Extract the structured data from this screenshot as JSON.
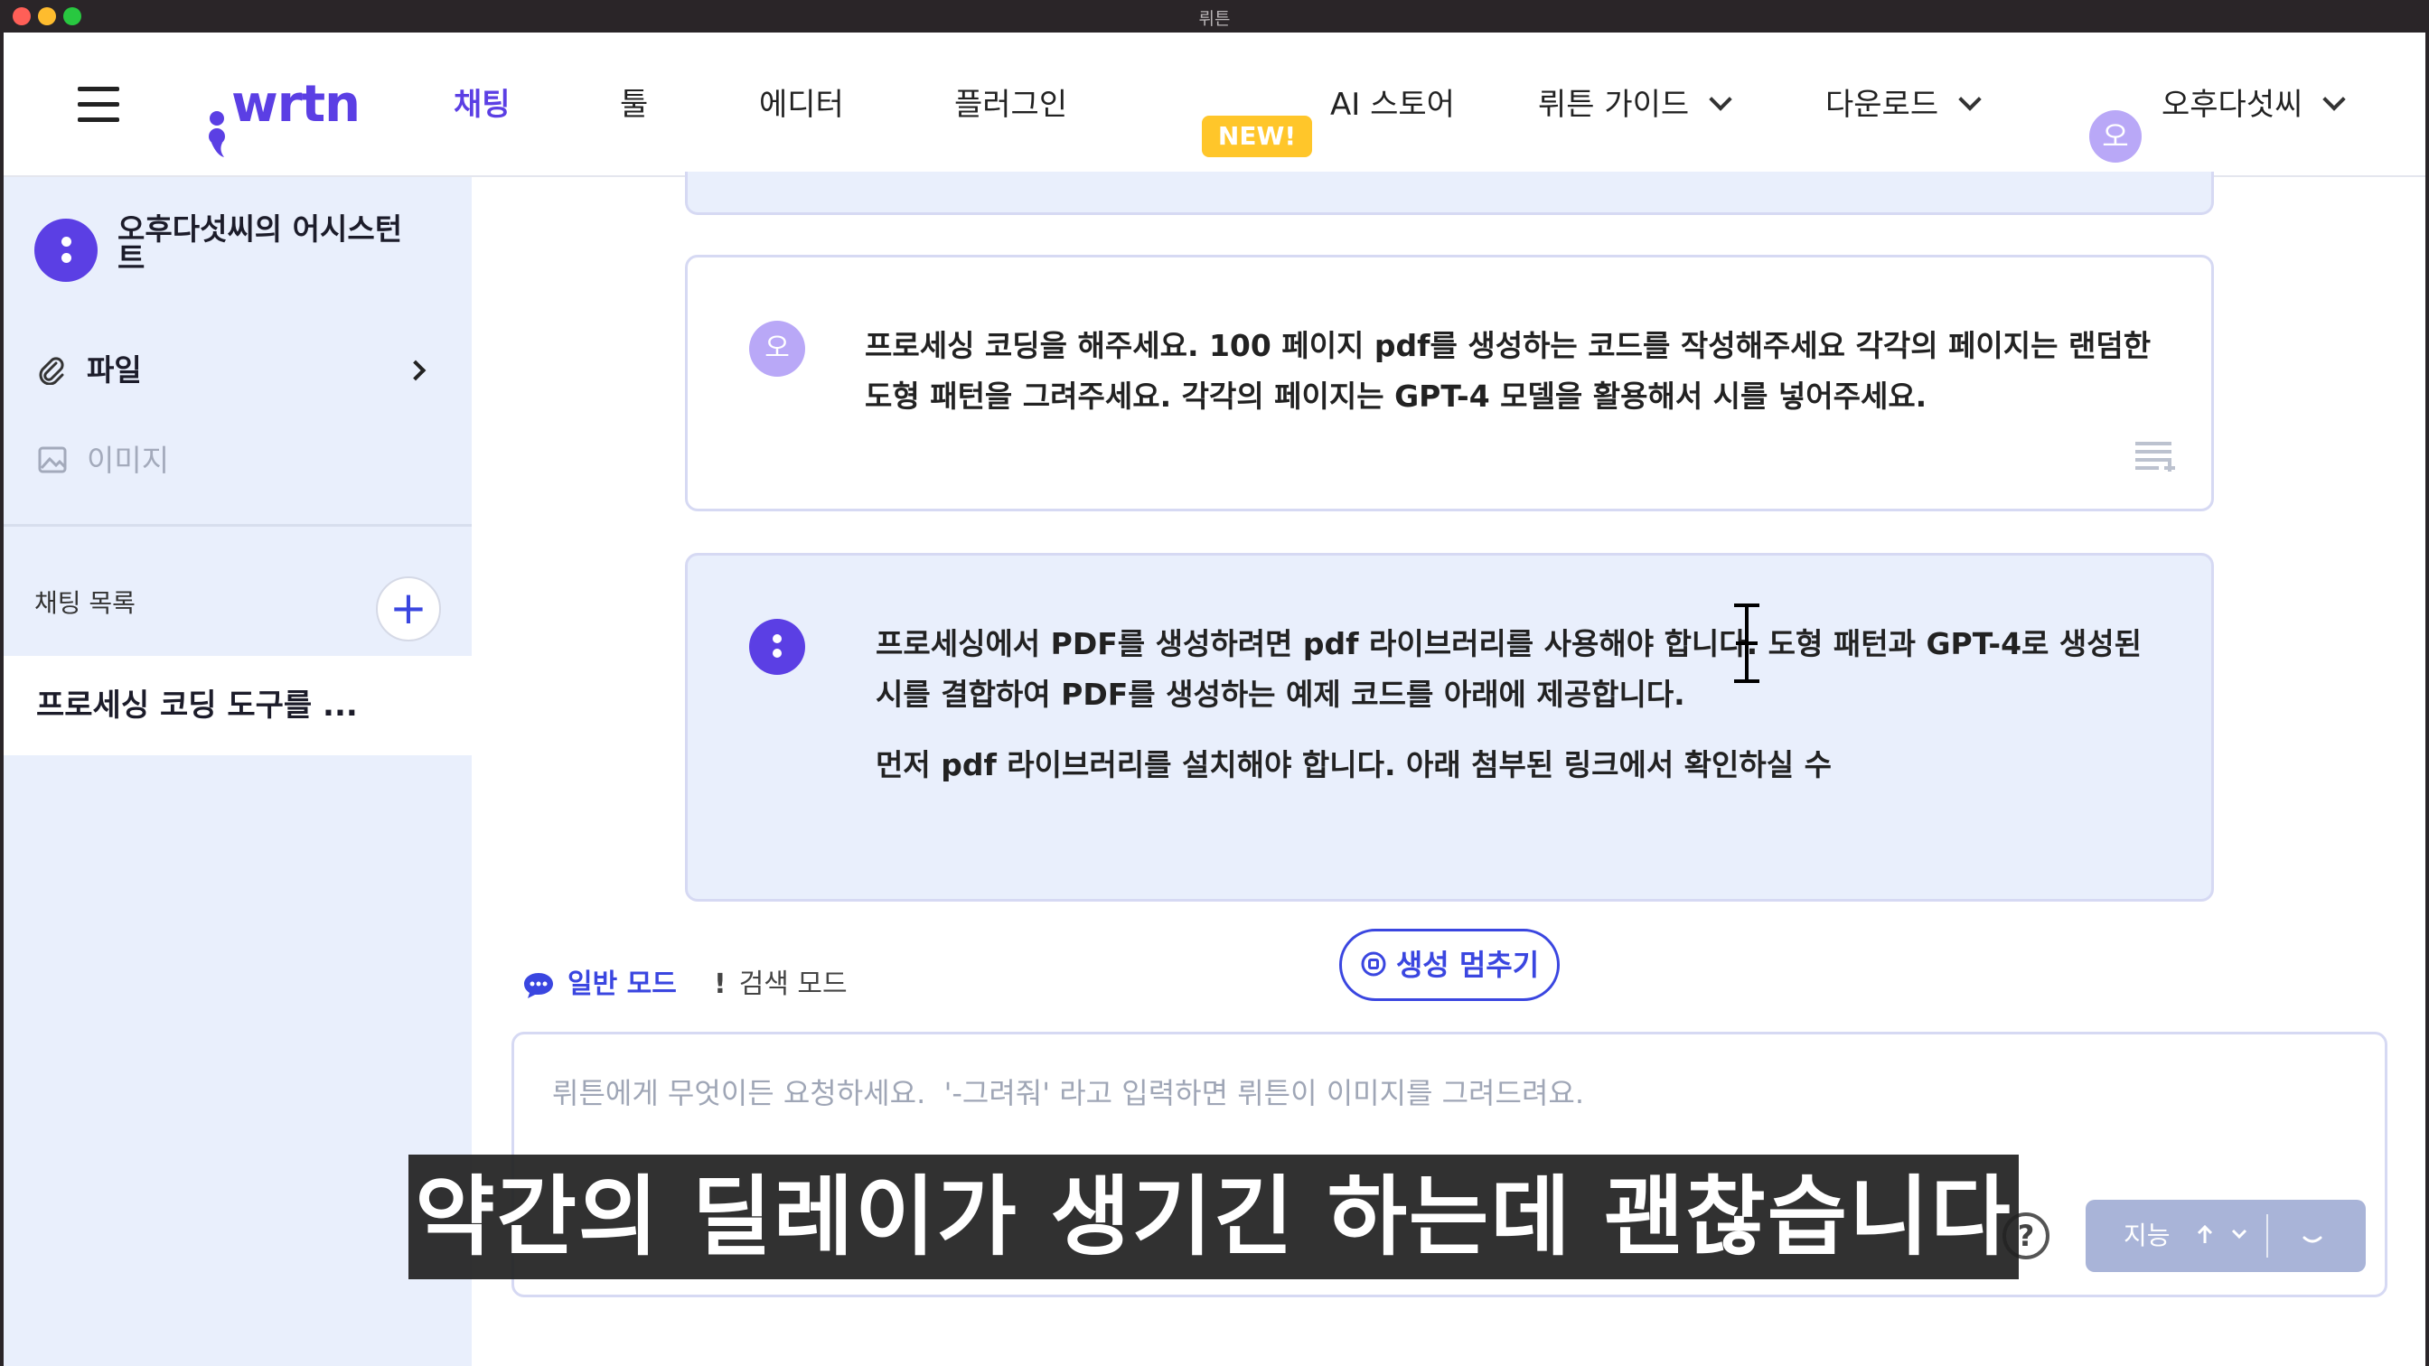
{
  "window": {
    "title": "뤼튼"
  },
  "nav": {
    "logo": "wrtn",
    "items": [
      "채팅",
      "툴",
      "에디터",
      "플러그인"
    ],
    "new_badge": "NEW!",
    "ai_store": "AI 스토어",
    "guide": "뤼튼 가이드",
    "download": "다운로드",
    "user_initial": "오",
    "user_name": "오후다섯씨"
  },
  "sidebar": {
    "assistant_name": "오후다섯씨의 어시스턴트",
    "files": "파일",
    "images": "이미지",
    "chat_list_label": "채팅 목록",
    "add_symbol": "+",
    "chat_items": [
      "프로세싱 코딩 도구를 ..."
    ]
  },
  "messages": {
    "user_initial": "오",
    "user_text": "프로세싱 코딩을 해주세요. 100 페이지 pdf를 생성하는 코드를 작성해주세요 각각의 페이지는 랜덤한 도형 패턴을 그려주세요. 각각의 페이지는 GPT-4 모델을 활용해서 시를 넣어주세요.",
    "assistant_p1": "프로세싱에서 PDF를 생성하려면 pdf 라이브러리를 사용해야 합니다. 도형 패턴과 GPT-4로 생성된 시를 결합하여 PDF를 생성하는 예제 코드를 아래에 제공합니다.",
    "assistant_p2": "먼저 pdf 라이브러리를 설치해야 합니다. 아래 첨부된 링크에서 확인하실 수"
  },
  "modes": {
    "general": "일반 모드",
    "search": "검색 모드",
    "search_mark": "!"
  },
  "stop_label": "생성 멈추기",
  "input": {
    "placeholder": "뤼튼에게 무엇이든 요청하세요.  '-그려줘' 라고 입력하면 뤼튼이 이미지를 그려드려요."
  },
  "model_select": {
    "label": "지능"
  },
  "subtitle": "약간의 딜레이가 생기긴 하는데 괜찮습니다",
  "colors": {
    "brand": "#5b3fe4",
    "accent": "#3a46e0",
    "badge": "#ffc62a",
    "sidebar_bg": "#e9effc"
  },
  "icons": [
    "menu-icon",
    "paperclip-icon",
    "image-icon",
    "plus-icon",
    "chevron-down-icon",
    "chat-bubble-icon",
    "stop-icon",
    "help-icon",
    "copy-icon"
  ]
}
